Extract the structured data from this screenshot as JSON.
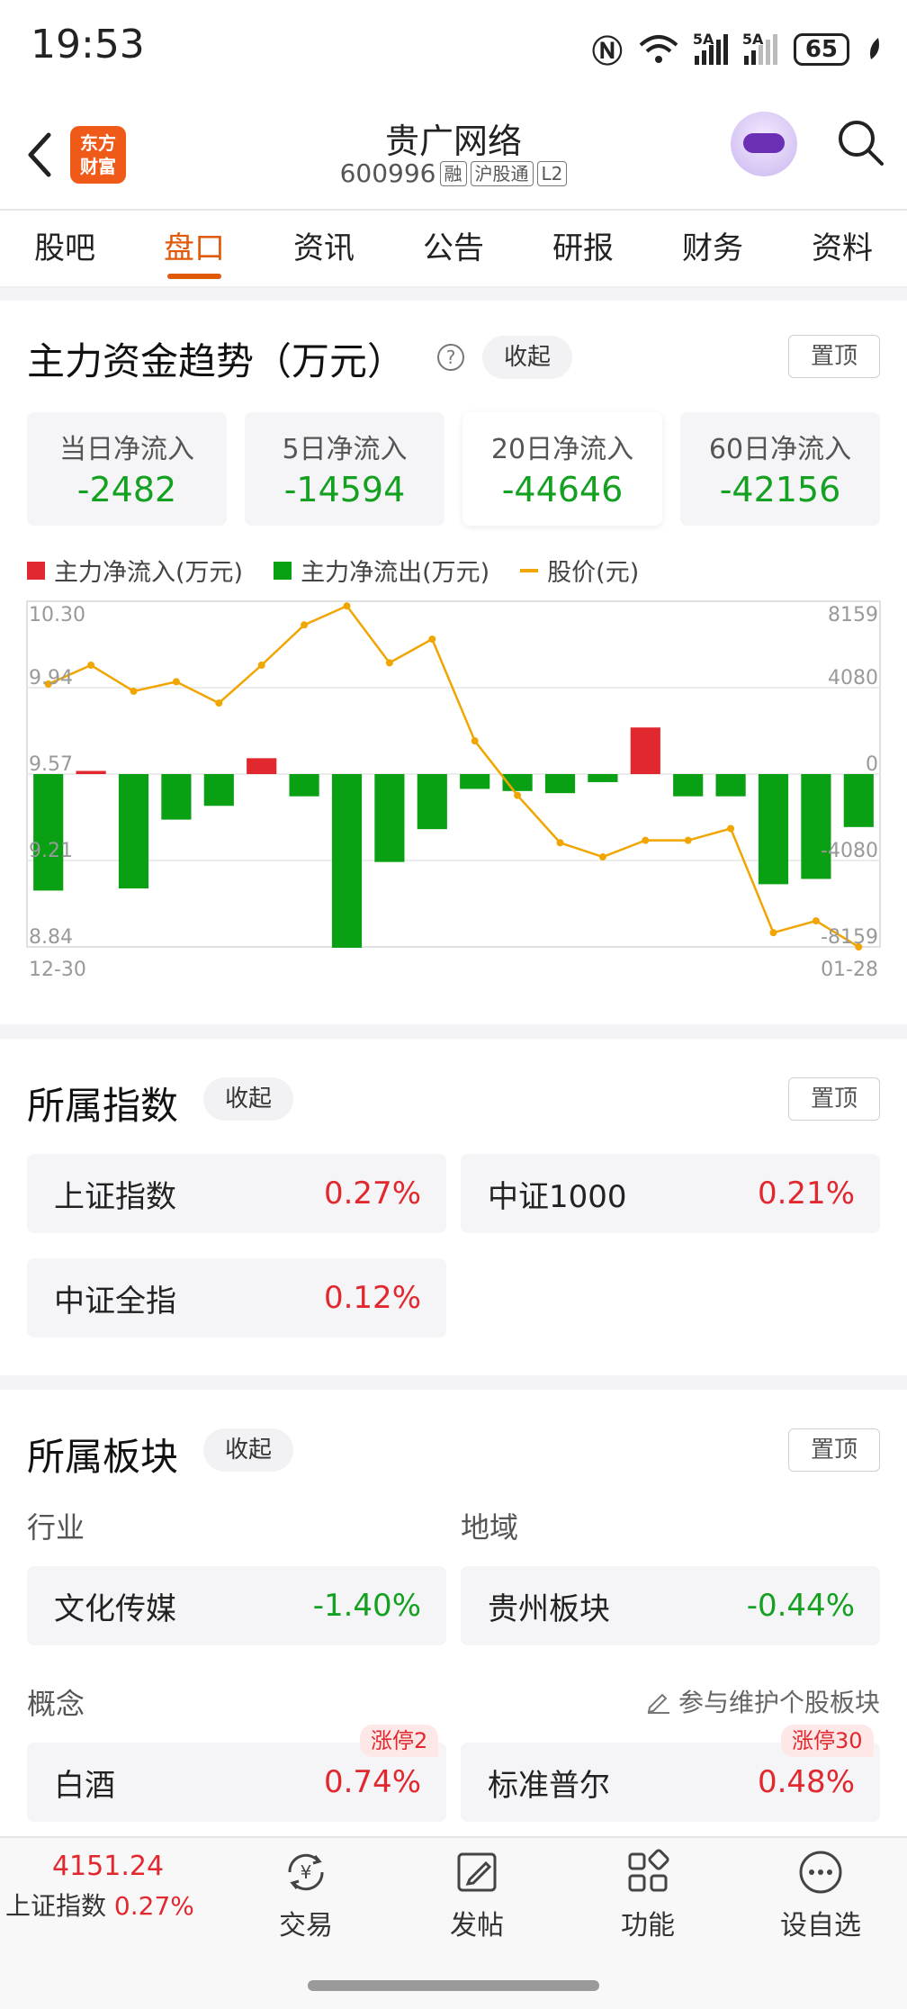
{
  "status_bar": {
    "time": "19:53",
    "battery": "65",
    "signal1_label": "5A",
    "signal2_label": "5A"
  },
  "header": {
    "logo_line1": "东方",
    "logo_line2": "财富",
    "stock_name": "贵广网络",
    "stock_code": "600996",
    "tags": [
      "融",
      "沪股通",
      "L2"
    ]
  },
  "tabs": [
    "股吧",
    "盘口",
    "资讯",
    "公告",
    "研报",
    "财务",
    "资料"
  ],
  "active_tab": "盘口",
  "fund_section": {
    "title": "主力资金趋势（万元）",
    "collapse_label": "收起",
    "pin_label": "置顶",
    "flows": [
      {
        "label": "当日净流入",
        "value": "-2482"
      },
      {
        "label": "5日净流入",
        "value": "-14594"
      },
      {
        "label": "20日净流入",
        "value": "-44646"
      },
      {
        "label": "60日净流入",
        "value": "-42156"
      }
    ],
    "legend": {
      "inflow": "主力净流入(万元)",
      "outflow": "主力净流出(万元)",
      "price": "股价(元)"
    },
    "colors": {
      "inflow": "#e0282e",
      "outflow": "#0aa014",
      "price": "#f0a500"
    }
  },
  "chart_data": {
    "type": "bar",
    "x_start_label": "12-30",
    "x_end_label": "01-28",
    "left_ticks": [
      "10.30",
      "9.94",
      "9.57",
      "9.21",
      "8.84"
    ],
    "right_ticks": [
      "8159",
      "4080",
      "0",
      "-4080",
      "-8159"
    ],
    "ylim_flow": [
      -8159,
      8159
    ],
    "ylim_price": [
      8.84,
      10.3
    ],
    "flow_series": {
      "name": "主力净流入(万元)",
      "values": [
        -5500,
        150,
        -5400,
        -2150,
        -1500,
        750,
        -1050,
        -8200,
        -4150,
        -2600,
        -700,
        -800,
        -900,
        -380,
        2200,
        -1050,
        -1050,
        -5200,
        -4950,
        -2500
      ]
    },
    "price_series": {
      "name": "股价(元)",
      "values": [
        9.95,
        10.03,
        9.92,
        9.96,
        9.87,
        10.03,
        10.2,
        10.28,
        10.04,
        10.14,
        9.71,
        9.48,
        9.28,
        9.22,
        9.29,
        9.29,
        9.34,
        8.9,
        8.95,
        8.84
      ]
    }
  },
  "index_section": {
    "title": "所属指数",
    "collapse_label": "收起",
    "pin_label": "置顶",
    "items": [
      {
        "name": "上证指数",
        "value": "0.27%"
      },
      {
        "name": "中证1000",
        "value": "0.21%"
      },
      {
        "name": "中证全指",
        "value": "0.12%"
      }
    ]
  },
  "sector_section": {
    "title": "所属板块",
    "collapse_label": "收起",
    "pin_label": "置顶",
    "industry_label": "行业",
    "region_label": "地域",
    "industry": {
      "name": "文化传媒",
      "value": "-1.40%"
    },
    "region": {
      "name": "贵州板块",
      "value": "-0.44%"
    },
    "concept_label": "概念",
    "maintain_label": "参与维护个股板块",
    "concepts": [
      {
        "name": "白酒",
        "value": "0.74%",
        "badge": "涨停2"
      },
      {
        "name": "标准普尔",
        "value": "0.48%",
        "badge": "涨停30"
      }
    ]
  },
  "bottom_bar": {
    "index_value": "4151.24",
    "index_name": "上证指数",
    "index_change": "0.27%",
    "buttons": [
      "交易",
      "发帖",
      "功能",
      "设自选"
    ]
  }
}
